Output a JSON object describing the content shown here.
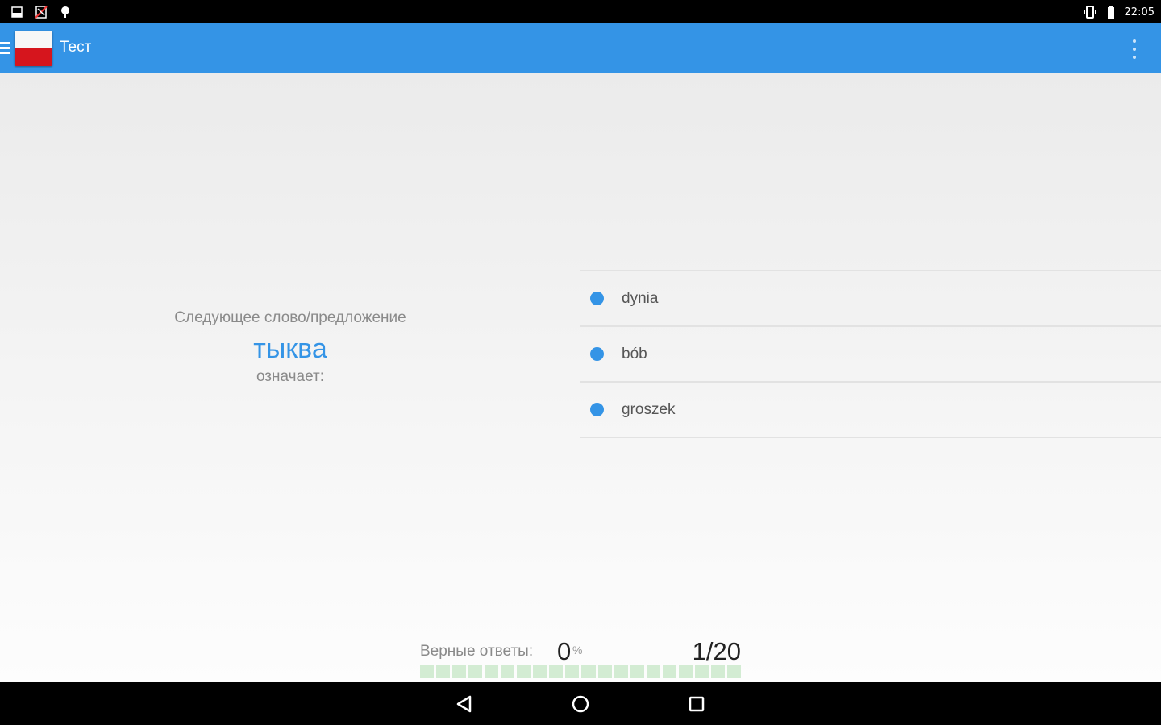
{
  "status_bar": {
    "time": "22:05",
    "left_icons": [
      "notification-icon",
      "no-sim-icon",
      "location-icon"
    ],
    "right_icons": [
      "vibrate-icon",
      "battery-icon"
    ]
  },
  "app_bar": {
    "title": "Тест",
    "menu_icon": "hamburger-icon",
    "overflow_icon": "more-vert-icon",
    "accent_color": "#3494e6"
  },
  "question": {
    "label": "Следующее слово/предложение",
    "word": "тыква",
    "means": "означает:"
  },
  "options": [
    {
      "label": "dynia"
    },
    {
      "label": "bób"
    },
    {
      "label": "groszek"
    }
  ],
  "progress": {
    "correct_label": "Верные ответы:",
    "correct_value": "0",
    "correct_unit": "%",
    "counter": "1/20",
    "segments_total": 20,
    "segments_filled": 0,
    "segment_color": "#d3ecd3"
  },
  "nav_bar": {
    "buttons": [
      "back-icon",
      "home-icon",
      "recents-icon"
    ]
  }
}
